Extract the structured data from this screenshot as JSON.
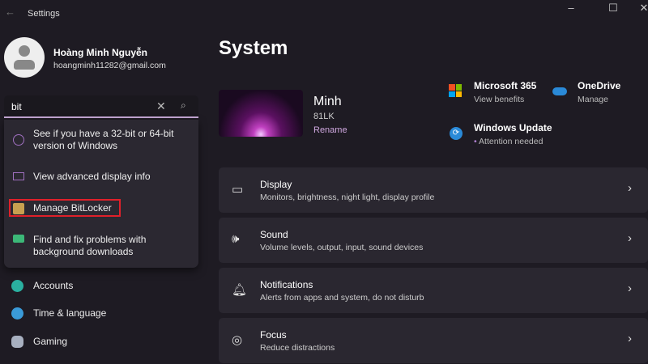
{
  "window": {
    "title": "Settings"
  },
  "user": {
    "name": "Hoàng Minh Nguyễn",
    "email": "hoangminh11282@gmail.com"
  },
  "search": {
    "value": "bit"
  },
  "results": [
    {
      "line1": "See if you have a 32-bit or 64-bit",
      "line2": "version of Windows"
    },
    {
      "line1": "View advanced display info"
    },
    {
      "line1": "Manage BitLocker"
    },
    {
      "line1": "Find and fix problems with",
      "line2": "background downloads"
    }
  ],
  "nav": [
    {
      "label": "Accounts"
    },
    {
      "label": "Time & language"
    },
    {
      "label": "Gaming"
    }
  ],
  "main": {
    "title": "System",
    "device": {
      "name": "Minh",
      "model": "81LK",
      "rename": "Rename"
    },
    "tiles": [
      {
        "title": "Microsoft 365",
        "sub": "View benefits"
      },
      {
        "title": "OneDrive",
        "sub": "Manage"
      },
      {
        "title": "Windows Update",
        "sub": "Attention needed"
      }
    ],
    "cards": [
      {
        "title": "Display",
        "sub": "Monitors, brightness, night light, display profile"
      },
      {
        "title": "Sound",
        "sub": "Volume levels, output, input, sound devices"
      },
      {
        "title": "Notifications",
        "sub": "Alerts from apps and system, do not disturb"
      },
      {
        "title": "Focus",
        "sub": "Reduce distractions"
      }
    ]
  }
}
